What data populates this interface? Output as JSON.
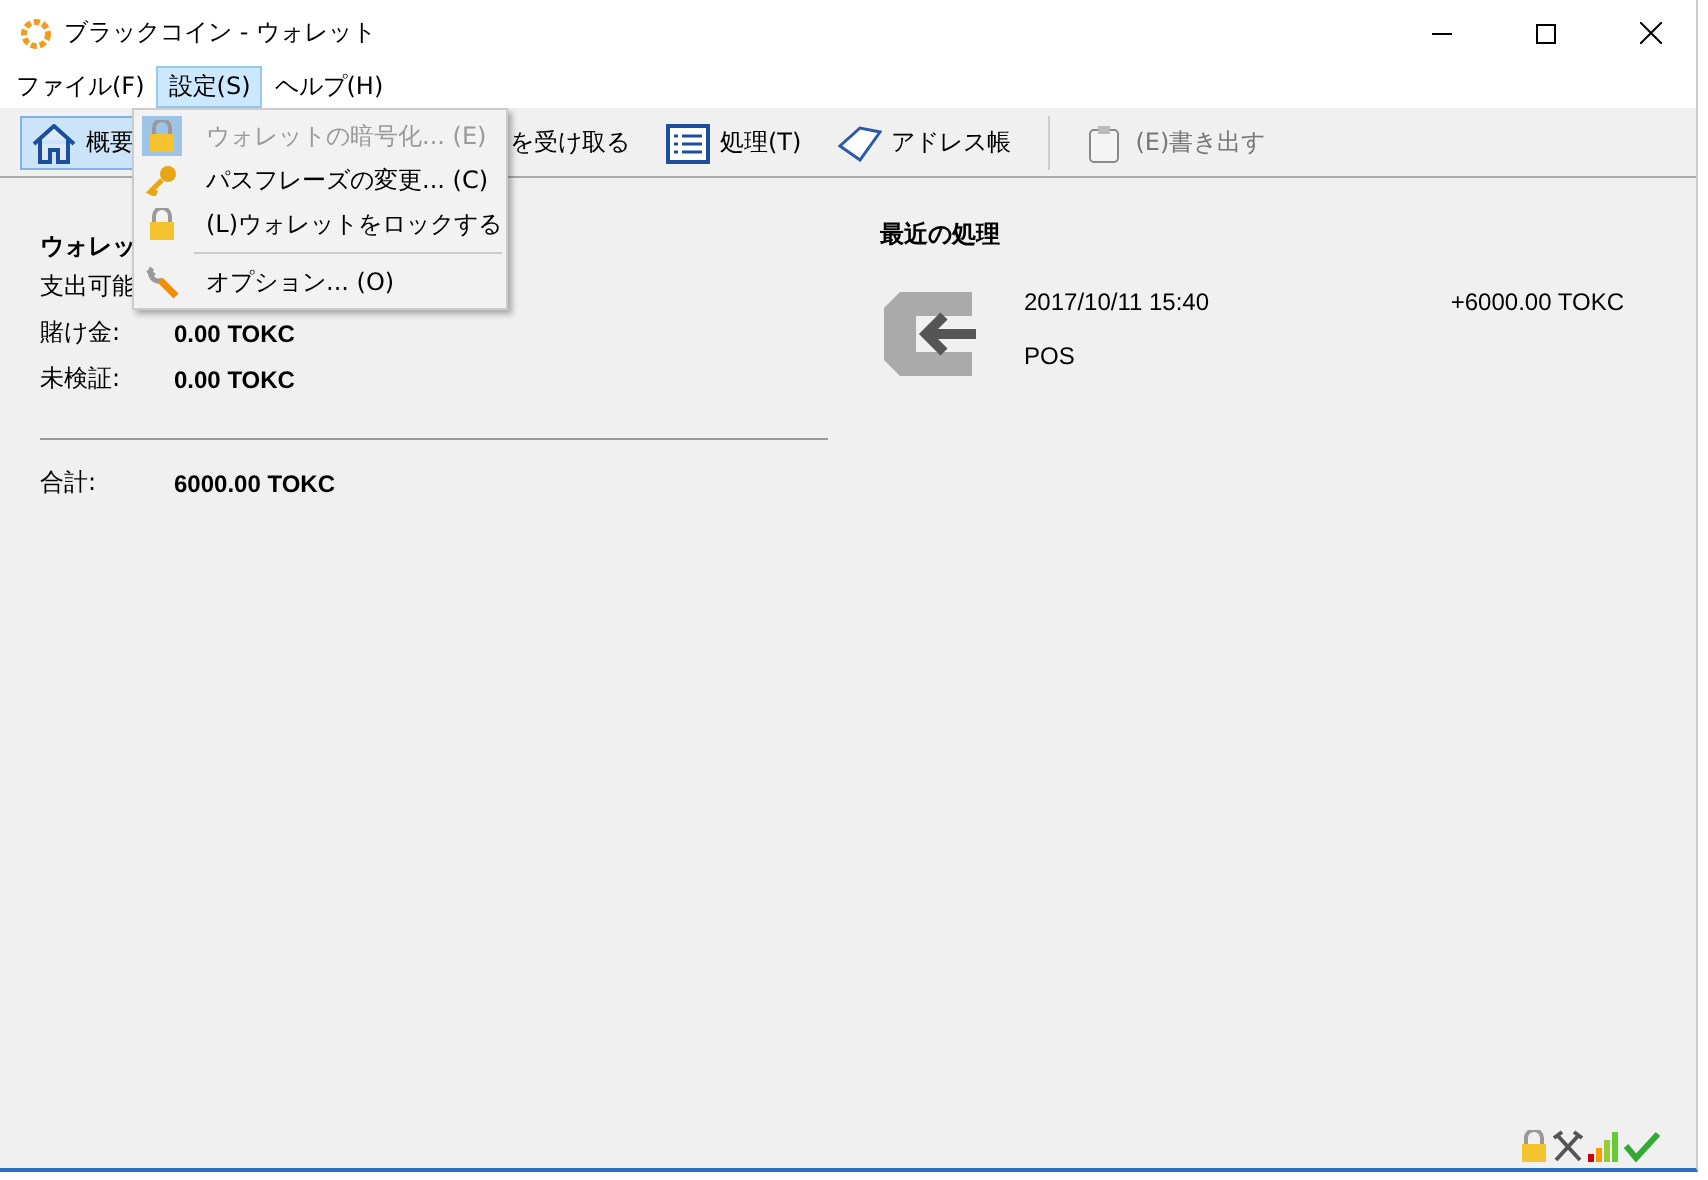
{
  "window": {
    "title": "ブラックコイン - ウォレット"
  },
  "menubar": [
    {
      "label": "ファイル(F)",
      "selected": false
    },
    {
      "label": "設定(S)",
      "selected": true
    },
    {
      "label": "ヘルプ(H)",
      "selected": false
    }
  ],
  "menu": {
    "items": [
      {
        "kind": "item",
        "label": "ウォレットの暗号化... (E)",
        "disabled": true,
        "highlighted": true
      },
      {
        "kind": "item",
        "label": "パスフレーズの変更... (C)",
        "disabled": false,
        "highlighted": false
      },
      {
        "kind": "item",
        "label": "(L)ウォレットをロックする",
        "disabled": false,
        "highlighted": false
      },
      {
        "kind": "separator"
      },
      {
        "kind": "item",
        "label": "オプション... (O)",
        "disabled": false,
        "highlighted": false
      }
    ]
  },
  "toolbar": [
    {
      "label": "概要",
      "selected": true,
      "disabled": false
    },
    {
      "label": "を受け取る",
      "selected": false,
      "disabled": false
    },
    {
      "label": "処理(T)",
      "selected": false,
      "disabled": false
    },
    {
      "label": "アドレス帳",
      "selected": false,
      "disabled": false
    },
    {
      "label": "(E)書き出す",
      "selected": false,
      "disabled": true
    }
  ],
  "wallet": {
    "title": "ウォレッ",
    "spendable_label": "支出可能",
    "rows": [
      {
        "label": "賭け金:",
        "value": "0.00 TOKC"
      },
      {
        "label": "未検証:",
        "value": "0.00 TOKC"
      }
    ],
    "total": {
      "label": "合計:",
      "value": "6000.00 TOKC"
    }
  },
  "recent": {
    "title": "最近の処理",
    "transactions": [
      {
        "date": "2017/10/11 15:40",
        "amount": "+6000.00 TOKC",
        "type": "POS"
      }
    ]
  }
}
